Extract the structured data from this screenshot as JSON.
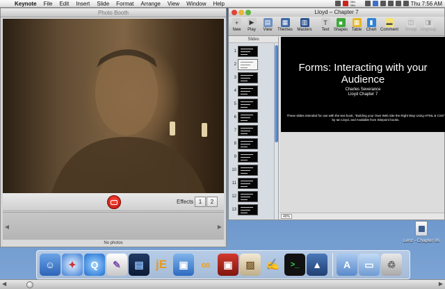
{
  "menubar": {
    "apple_glyph": "",
    "app_name": "Keynote",
    "menus": [
      "File",
      "Edit",
      "Insert",
      "Slide",
      "Format",
      "Arrange",
      "View",
      "Window",
      "Help"
    ],
    "cpu_top": "08/s",
    "cpu_bottom": "08/s",
    "clock": "Thu 7:56 AM"
  },
  "photobooth": {
    "title": "Photo Booth",
    "effects_label": "Effects",
    "effects_buttons": [
      "1",
      "2"
    ],
    "strip_status": "No photos"
  },
  "keynote": {
    "title": "Lloyd – Chapter 7",
    "toolbar": [
      {
        "label": "New",
        "icon": "new-icon",
        "enabled": true
      },
      {
        "label": "Play",
        "icon": "play-icon",
        "enabled": true
      },
      {
        "label": "View",
        "icon": "view-icon",
        "enabled": true
      },
      {
        "label": "Themes",
        "icon": "themes-icon",
        "enabled": true
      },
      {
        "label": "Masters",
        "icon": "masters-icon",
        "enabled": true
      },
      {
        "label": "Text",
        "icon": "text-icon",
        "enabled": true
      },
      {
        "label": "Shapes",
        "icon": "shapes-icon",
        "enabled": true
      },
      {
        "label": "Table",
        "icon": "table-icon",
        "enabled": true
      },
      {
        "label": "Chart",
        "icon": "chart-icon",
        "enabled": true
      },
      {
        "label": "Comment",
        "icon": "comment-icon",
        "enabled": true
      },
      {
        "label": "Group",
        "icon": "group-icon",
        "enabled": false
      },
      {
        "label": "Ungroup",
        "icon": "ungroup-icon",
        "enabled": false
      }
    ],
    "navigator": {
      "header": "Slides",
      "slides": [
        "1",
        "2",
        "3",
        "4",
        "5",
        "6",
        "7",
        "8",
        "9",
        "10",
        "11",
        "12",
        "13"
      ]
    },
    "slide": {
      "title": "Forms: Interacting with your Audience",
      "subtitle_line1": "Charles Severance",
      "subtitle_line2": "Lloyd Chapter 7",
      "body": "These slides intended for use with the text book, \"Building your Own Web Site the Right Way Using HTML & CSS\" by Ian Lloyd, and Available from Sitepoint books."
    },
    "zoom": "40%"
  },
  "desktop": {
    "file_label": "Lenz - Chapter 06"
  },
  "dock": {
    "apps": [
      "Finder",
      "Safari",
      "QuickTime Player",
      "iChat",
      "iMovie",
      "jEdit",
      "System Preferences",
      "Mail",
      "Photo Booth",
      "Preview",
      "Script Editor",
      "Terminal",
      "Keynote"
    ],
    "extras": [
      "Applications",
      "Documents",
      "Trash"
    ]
  },
  "colors": {
    "desktop": "#5b87c0",
    "slide_bg": "#000000",
    "shutter": "#d8201a"
  }
}
